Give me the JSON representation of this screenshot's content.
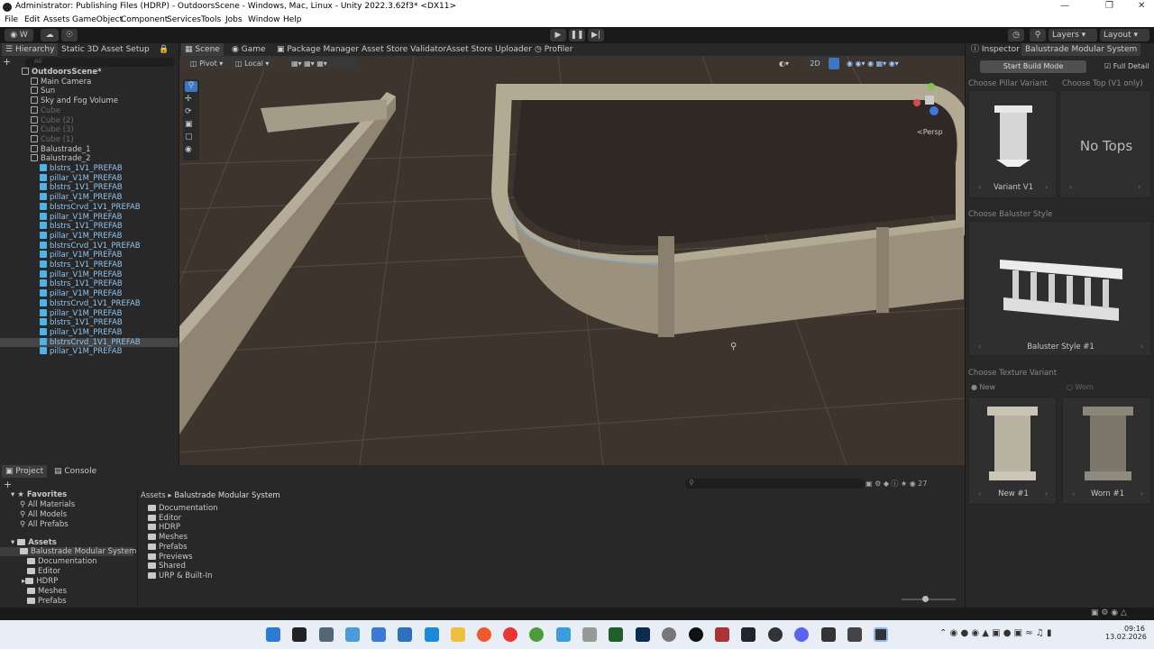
{
  "window": {
    "title": "Administrator: Publishing Files (HDRP) - OutdoorsScene - Windows, Mac, Linux - Unity 2022.3.62f3* <DX11>"
  },
  "menu": [
    "File",
    "Edit",
    "Assets",
    "GameObject",
    "Component",
    "Services",
    "Tools",
    "Jobs",
    "Window",
    "Help"
  ],
  "toolbar": {
    "account": "W",
    "layers": "Layers",
    "layout": "Layout"
  },
  "hierarchy": {
    "tabs": [
      "Hierarchy",
      "Static 3D Asset Setup"
    ],
    "search_placeholder": "All",
    "items": [
      {
        "label": "OutdoorsScene*",
        "indent": 0,
        "type": "scene"
      },
      {
        "label": "Main Camera",
        "indent": 1,
        "type": "go"
      },
      {
        "label": "Sun",
        "indent": 1,
        "type": "go"
      },
      {
        "label": "Sky and Fog Volume",
        "indent": 1,
        "type": "go"
      },
      {
        "label": "Cube",
        "indent": 1,
        "type": "dim"
      },
      {
        "label": "Cube (2)",
        "indent": 1,
        "type": "dim"
      },
      {
        "label": "Cube (3)",
        "indent": 1,
        "type": "dim"
      },
      {
        "label": "Cube (1)",
        "indent": 1,
        "type": "dim"
      },
      {
        "label": "Balustrade_1",
        "indent": 1,
        "type": "go"
      },
      {
        "label": "Balustrade_2",
        "indent": 1,
        "type": "go"
      },
      {
        "label": "blstrs_1V1_PREFAB",
        "indent": 2,
        "type": "prefab"
      },
      {
        "label": "pillar_V1M_PREFAB",
        "indent": 2,
        "type": "prefab"
      },
      {
        "label": "blstrs_1V1_PREFAB",
        "indent": 2,
        "type": "prefab"
      },
      {
        "label": "pillar_V1M_PREFAB",
        "indent": 2,
        "type": "prefab"
      },
      {
        "label": "blstrsCrvd_1V1_PREFAB",
        "indent": 2,
        "type": "prefab"
      },
      {
        "label": "pillar_V1M_PREFAB",
        "indent": 2,
        "type": "prefab"
      },
      {
        "label": "blstrs_1V1_PREFAB",
        "indent": 2,
        "type": "prefab"
      },
      {
        "label": "pillar_V1M_PREFAB",
        "indent": 2,
        "type": "prefab"
      },
      {
        "label": "blstrsCrvd_1V1_PREFAB",
        "indent": 2,
        "type": "prefab"
      },
      {
        "label": "pillar_V1M_PREFAB",
        "indent": 2,
        "type": "prefab"
      },
      {
        "label": "blstrs_1V1_PREFAB",
        "indent": 2,
        "type": "prefab"
      },
      {
        "label": "pillar_V1M_PREFAB",
        "indent": 2,
        "type": "prefab"
      },
      {
        "label": "blstrs_1V1_PREFAB",
        "indent": 2,
        "type": "prefab"
      },
      {
        "label": "pillar_V1M_PREFAB",
        "indent": 2,
        "type": "prefab"
      },
      {
        "label": "blstrsCrvd_1V1_PREFAB",
        "indent": 2,
        "type": "prefab"
      },
      {
        "label": "pillar_V1M_PREFAB",
        "indent": 2,
        "type": "prefab"
      },
      {
        "label": "blstrs_1V1_PREFAB",
        "indent": 2,
        "type": "prefab"
      },
      {
        "label": "pillar_V1M_PREFAB",
        "indent": 2,
        "type": "prefab"
      },
      {
        "label": "blstrsCrvd_1V1_PREFAB",
        "indent": 2,
        "type": "prefab",
        "selected": true
      },
      {
        "label": "pillar_V1M_PREFAB",
        "indent": 2,
        "type": "prefab"
      }
    ]
  },
  "scene_tabs": [
    "Scene",
    "Game",
    "Package Manager",
    "Asset Store Validator",
    "Asset Store Uploader",
    "Profiler"
  ],
  "scene": {
    "pivot": "Pivot",
    "local": "Local",
    "mode_2d": "2D",
    "persp": "<Persp"
  },
  "inspector": {
    "tabs": [
      "Inspector",
      "Balustrade Modular System"
    ],
    "build_button": "Start Build Mode",
    "full_detail": "Full Detail",
    "pillar_section": "Choose Pillar Variant",
    "top_section": "Choose Top (V1 only)",
    "pillar_label": "Variant V1",
    "no_tops": "No Tops",
    "baluster_section": "Choose Baluster Style",
    "baluster_label": "Baluster Style #1",
    "texture_section": "Choose Texture Variant",
    "texture_new": "New",
    "texture_worn": "Worn",
    "new_label": "New #1",
    "worn_label": "Worn #1"
  },
  "project": {
    "tabs": [
      "Project",
      "Console"
    ],
    "favorites_label": "Favorites",
    "favorites": [
      "All Materials",
      "All Models",
      "All Prefabs"
    ],
    "assets_label": "Assets",
    "tree": [
      "Balustrade Modular System",
      "Documentation",
      "Editor",
      "HDRP",
      "Meshes",
      "Prefabs"
    ],
    "breadcrumb": [
      "Assets",
      "Balustrade Modular System"
    ],
    "folders": [
      "Documentation",
      "Editor",
      "HDRP",
      "Meshes",
      "Prefabs",
      "Previews",
      "Shared",
      "URP & Built-In"
    ],
    "count": "27"
  },
  "taskbar": {
    "time": "09:16",
    "date": "13.02.2026"
  }
}
